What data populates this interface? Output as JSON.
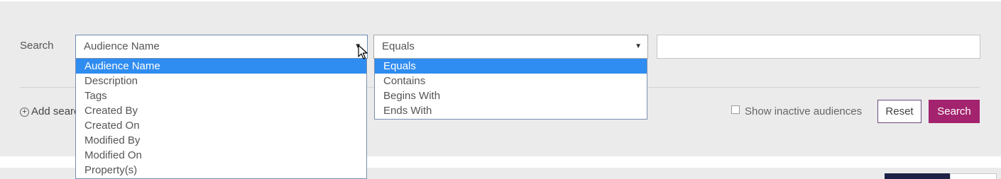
{
  "search": {
    "label": "Search",
    "field_select": {
      "value": "Audience Name",
      "options": [
        "Audience Name",
        "Description",
        "Tags",
        "Created By",
        "Created On",
        "Modified By",
        "Modified On",
        "Property(s)"
      ],
      "selected_index": 0
    },
    "operator_select": {
      "value": "Equals",
      "options": [
        "Equals",
        "Contains",
        "Begins With",
        "Ends With"
      ],
      "selected_index": 0
    },
    "value_input": {
      "value": ""
    }
  },
  "actions": {
    "add_search_label": "Add searc",
    "show_inactive_label": "Show inactive audiences",
    "show_inactive_checked": false,
    "reset_label": "Reset",
    "search_label": "Search"
  },
  "icons": {
    "dropdown_arrow": "caret-down-icon",
    "add": "plus-circle-icon",
    "cursor": "mouse-pointer-icon"
  },
  "colors": {
    "panel_bg": "#ebebeb",
    "search_button": "#a3236e",
    "highlight": "#2f8cf0",
    "dark_tab": "#1f2146"
  }
}
